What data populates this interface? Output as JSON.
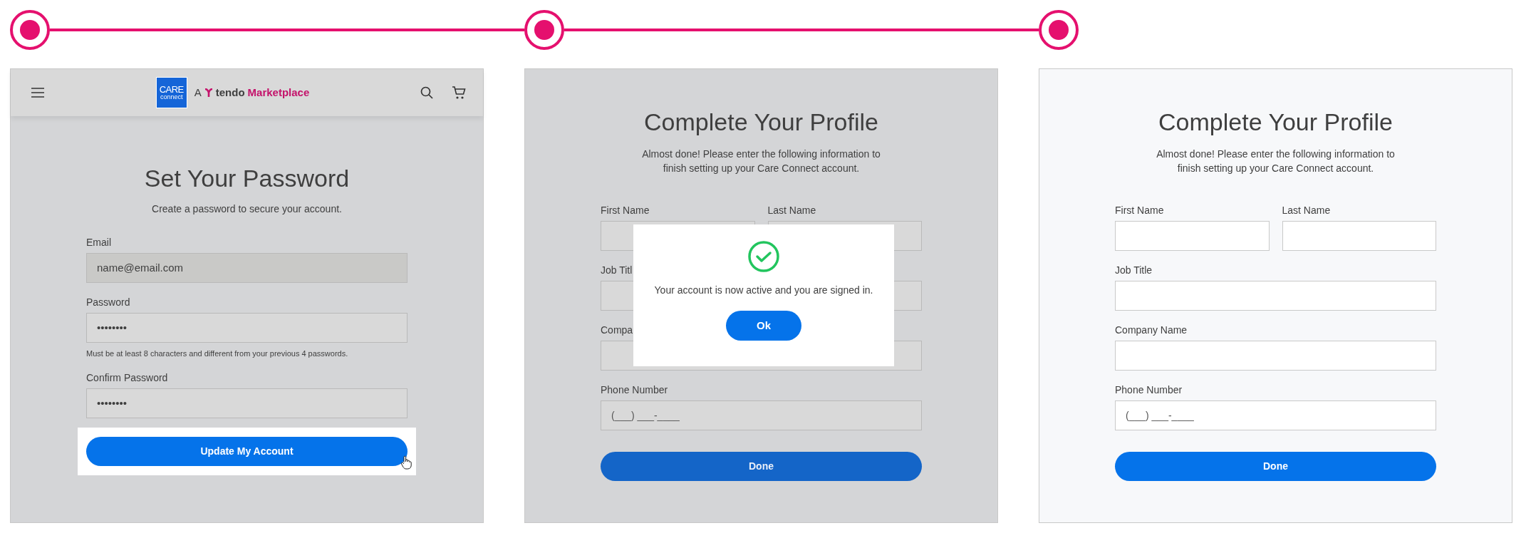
{
  "panels": [
    {
      "kind": "password",
      "dimmed": true,
      "header": {
        "logo_top": "CARE",
        "logo_bottom": "connect",
        "prefix": "A",
        "brand": "tendo",
        "product": "Marketplace"
      },
      "title": "Set Your Password",
      "subtitle": "Create a password to secure your account.",
      "fields": [
        {
          "label": "Email",
          "value": "name@email.com",
          "disabled": true,
          "kind": "full"
        },
        {
          "label": "Password",
          "value": "••••••••",
          "disabled": false,
          "kind": "full",
          "hint": "Must be at least 8 characters and different from your previous 4 passwords."
        },
        {
          "label": "Confirm Password",
          "value": "••••••••",
          "disabled": false,
          "kind": "full"
        }
      ],
      "button": {
        "label": "Update My Account",
        "spotlight": true
      }
    },
    {
      "kind": "profile",
      "dimmed": true,
      "title": "Complete Your Profile",
      "subtitle": "Almost done! Please enter the following information to finish setting up your Care Connect account.",
      "fields": [
        {
          "label": "First Name",
          "disabled": false,
          "kind": "half"
        },
        {
          "label": "Last Name",
          "disabled": false,
          "kind": "half"
        },
        {
          "label": "Job Titl",
          "disabled": false,
          "kind": "full"
        },
        {
          "label": "Compa",
          "disabled": false,
          "kind": "full"
        },
        {
          "label": "Phone Number",
          "placeholder": "(___) ___-____",
          "disabled": false,
          "kind": "full"
        }
      ],
      "button": {
        "label": "Done",
        "spotlight": false
      },
      "dialog": {
        "message": "Your account is now active and you are signed in.",
        "button": "Ok"
      }
    },
    {
      "kind": "profile",
      "dimmed": false,
      "title": "Complete Your Profile",
      "subtitle": "Almost done! Please enter the following information to finish setting up your Care Connect account.",
      "fields": [
        {
          "label": "First Name",
          "disabled": false,
          "kind": "half"
        },
        {
          "label": "Last Name",
          "disabled": false,
          "kind": "half"
        },
        {
          "label": "Job Title",
          "disabled": false,
          "kind": "full"
        },
        {
          "label": "Company Name",
          "disabled": false,
          "kind": "full"
        },
        {
          "label": "Phone Number",
          "placeholder": "(___) ___-____",
          "disabled": false,
          "kind": "full"
        }
      ],
      "button": {
        "label": "Done",
        "spotlight": false
      }
    }
  ]
}
